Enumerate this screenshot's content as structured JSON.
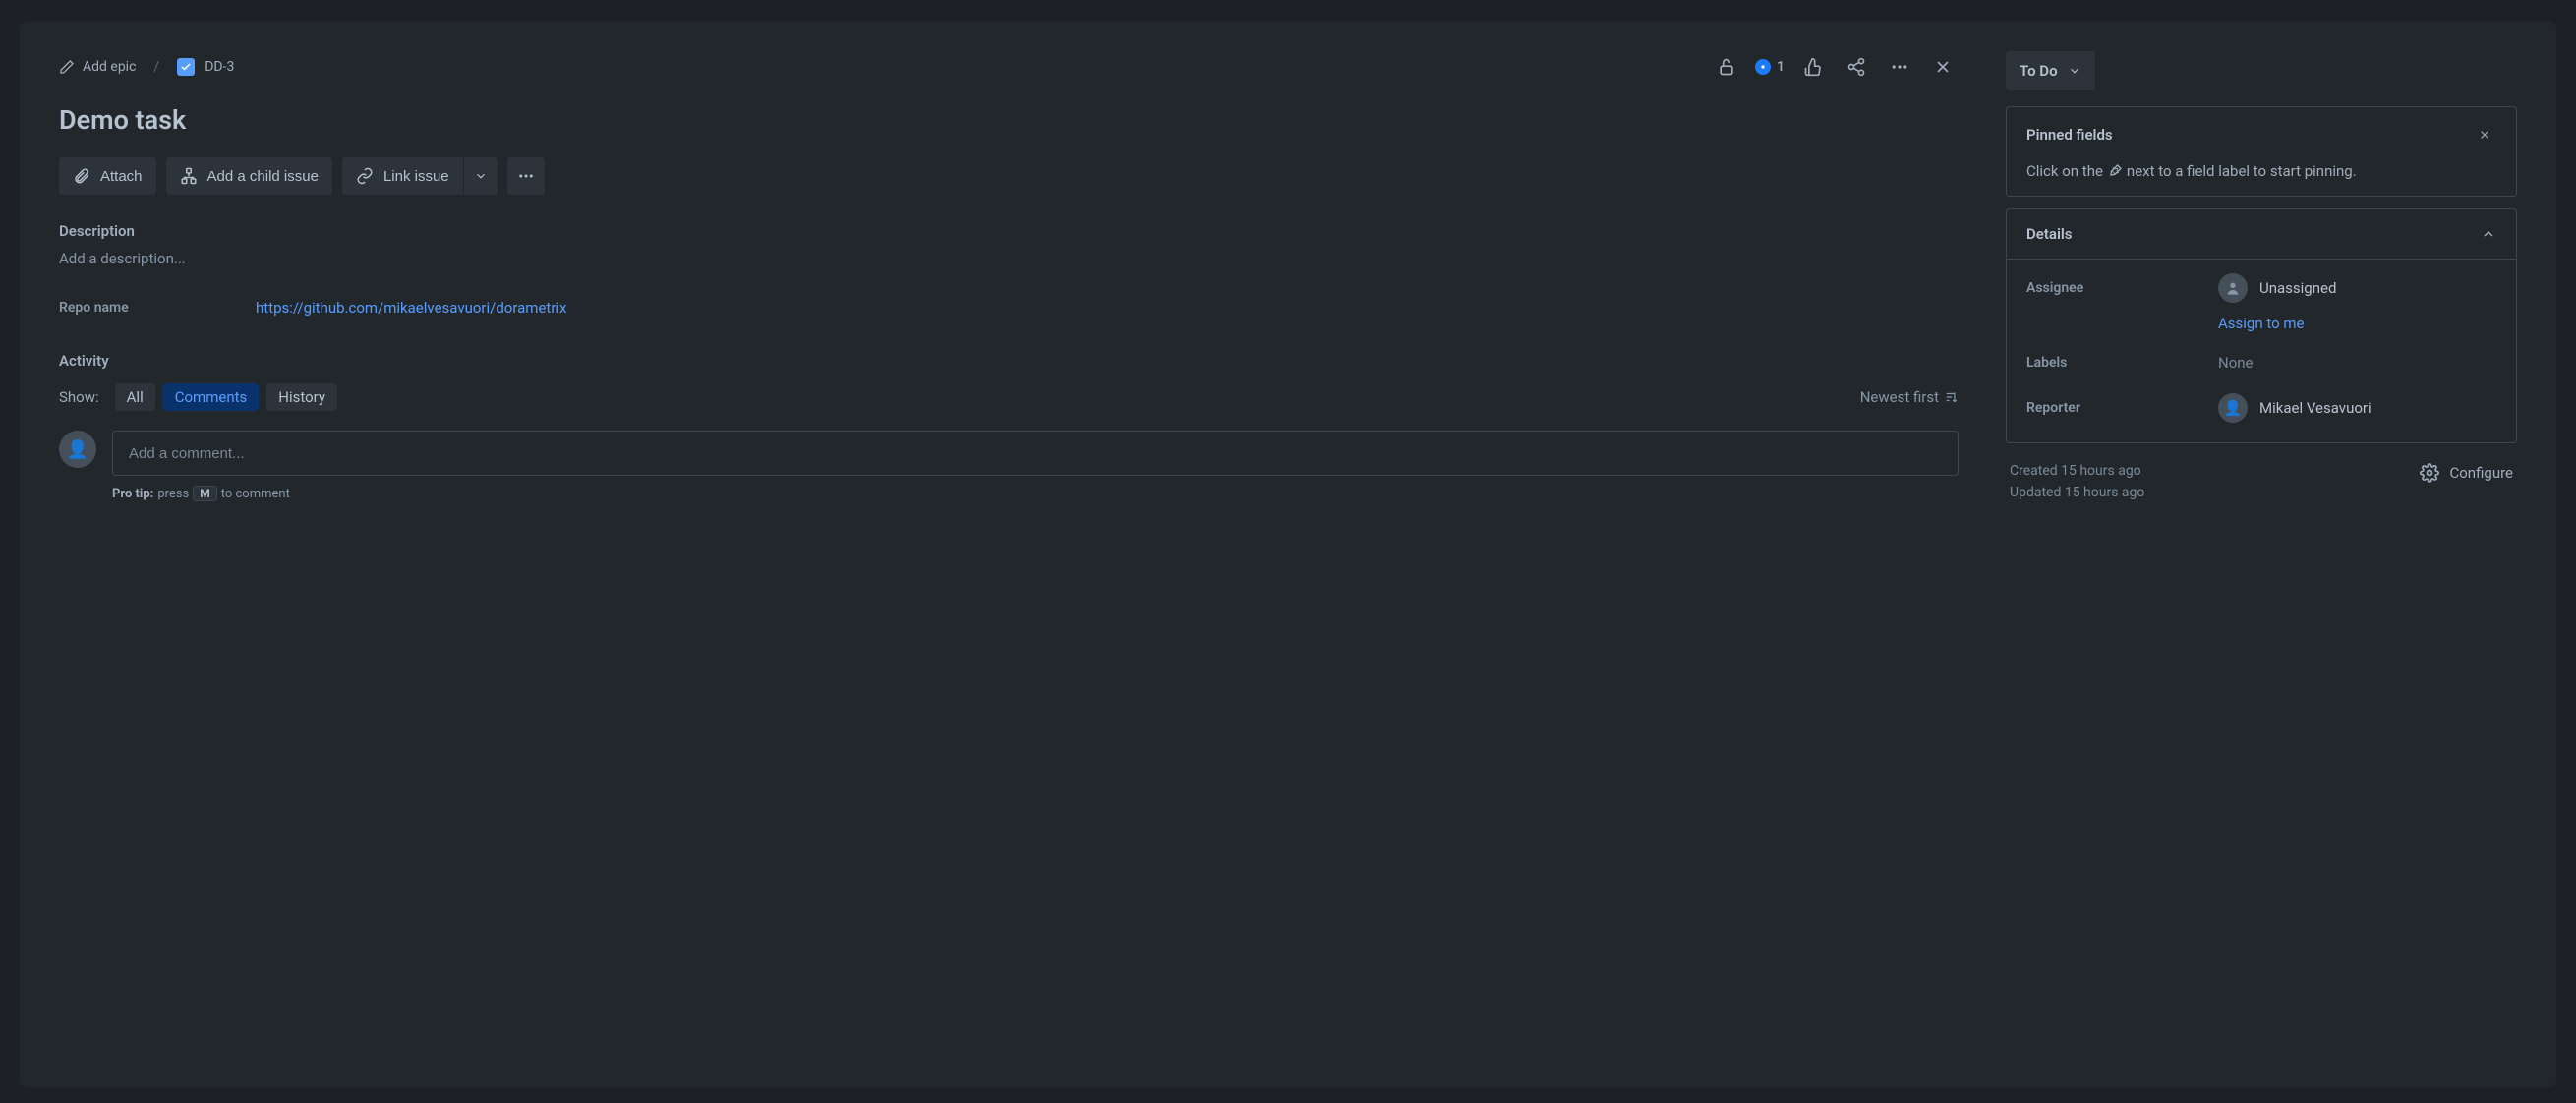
{
  "breadcrumb": {
    "add_epic": "Add epic",
    "issue_key": "DD-3"
  },
  "header_actions": {
    "watch_count": "1"
  },
  "title": "Demo task",
  "actions": {
    "attach": "Attach",
    "add_child": "Add a child issue",
    "link_issue": "Link issue"
  },
  "description": {
    "label": "Description",
    "placeholder": "Add a description..."
  },
  "custom_field": {
    "label": "Repo name",
    "value": "https://github.com/mikaelvesavuori/dorametrix"
  },
  "activity": {
    "label": "Activity",
    "show": "Show:",
    "tabs": {
      "all": "All",
      "comments": "Comments",
      "history": "History"
    },
    "sort": "Newest first",
    "comment_placeholder": "Add a comment...",
    "tip_prefix": "Pro tip:",
    "tip_press": "press",
    "tip_key": "M",
    "tip_suffix": "to comment"
  },
  "status": {
    "label": "To Do"
  },
  "pinned": {
    "title": "Pinned fields",
    "hint_before": "Click on the",
    "hint_after": "next to a field label to start pinning."
  },
  "details": {
    "title": "Details",
    "assignee_label": "Assignee",
    "assignee_value": "Unassigned",
    "assign_to_me": "Assign to me",
    "labels_label": "Labels",
    "labels_value": "None",
    "reporter_label": "Reporter",
    "reporter_value": "Mikael Vesavuori"
  },
  "meta": {
    "created": "Created 15 hours ago",
    "updated": "Updated 15 hours ago",
    "configure": "Configure"
  }
}
